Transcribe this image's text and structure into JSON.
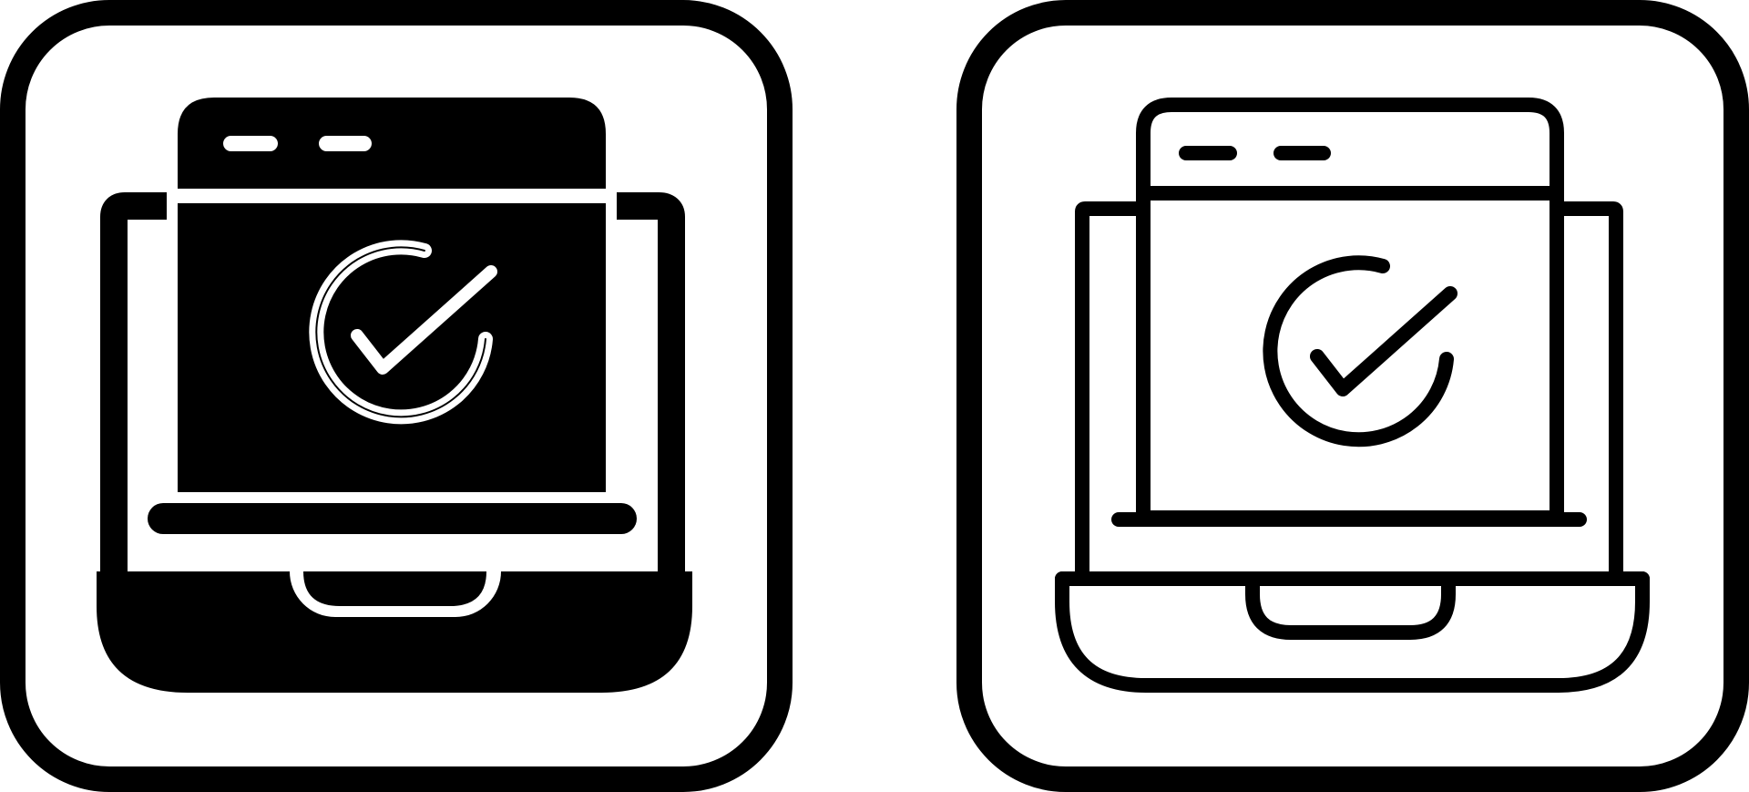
{
  "colors": {
    "background": "#ffffff",
    "ink": "#000000",
    "paper": "#ffffff"
  },
  "icons": [
    {
      "name": "laptop-check-glyph-icon",
      "style": "glyph"
    },
    {
      "name": "laptop-check-line-icon",
      "style": "line"
    }
  ]
}
